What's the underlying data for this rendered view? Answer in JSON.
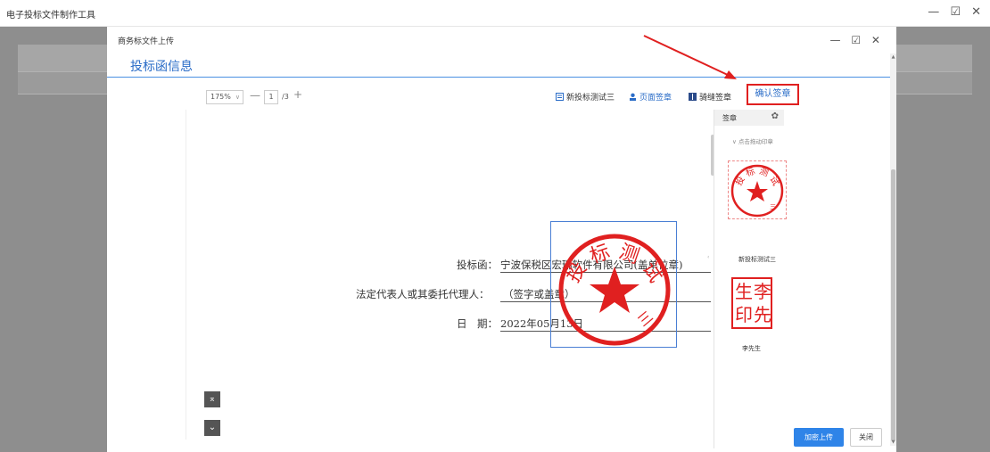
{
  "app": {
    "title": "电子投标文件制作工具",
    "controls": "— ☑ ✕"
  },
  "dialog": {
    "title": "商务标文件上传",
    "controls": "— ☑ ✕",
    "section_title": "投标函信息"
  },
  "toolbar": {
    "zoom": "175%",
    "zoom_out": "—",
    "page_current": "1",
    "page_total": "/3",
    "zoom_in": "+",
    "actions": [
      {
        "label": "新投标测试三",
        "icon": "seal-doc-icon"
      },
      {
        "label": "页面签章",
        "icon": "user-sign-icon"
      },
      {
        "label": "骑缝签章",
        "icon": "seam-sign-icon"
      }
    ],
    "confirm_label": "确认签章"
  },
  "document": {
    "line1_label": "投标函：",
    "line1_value": "宁波保税区宏瑞软件有限公司(盖单位章)",
    "line2_label": "法定代表人或其委托代理人：",
    "line2_value": "（签字或盖章）",
    "line3_label": "日　期：",
    "line3_value": "2022年05月13日",
    "nav_top": "⌅",
    "nav_bottom": "⌄"
  },
  "placed_stamp": {
    "top_text": "投 标 测 试",
    "bottom_text": "三"
  },
  "seal_panel": {
    "title": "签章",
    "hint": "∨ 点击拖动印章",
    "seals": [
      {
        "name": "新投标测试三",
        "ring_text": "投 标 测 试",
        "inner_text": "三"
      },
      {
        "name": "李先生",
        "chars": [
          "生",
          "李",
          "印",
          "先"
        ]
      }
    ]
  },
  "footer": {
    "upload_label": "加密上传",
    "close_label": "关闭"
  },
  "colors": {
    "accent": "#2a6cc7",
    "seal_red": "#e02020",
    "upload_button": "#2f84e8"
  }
}
